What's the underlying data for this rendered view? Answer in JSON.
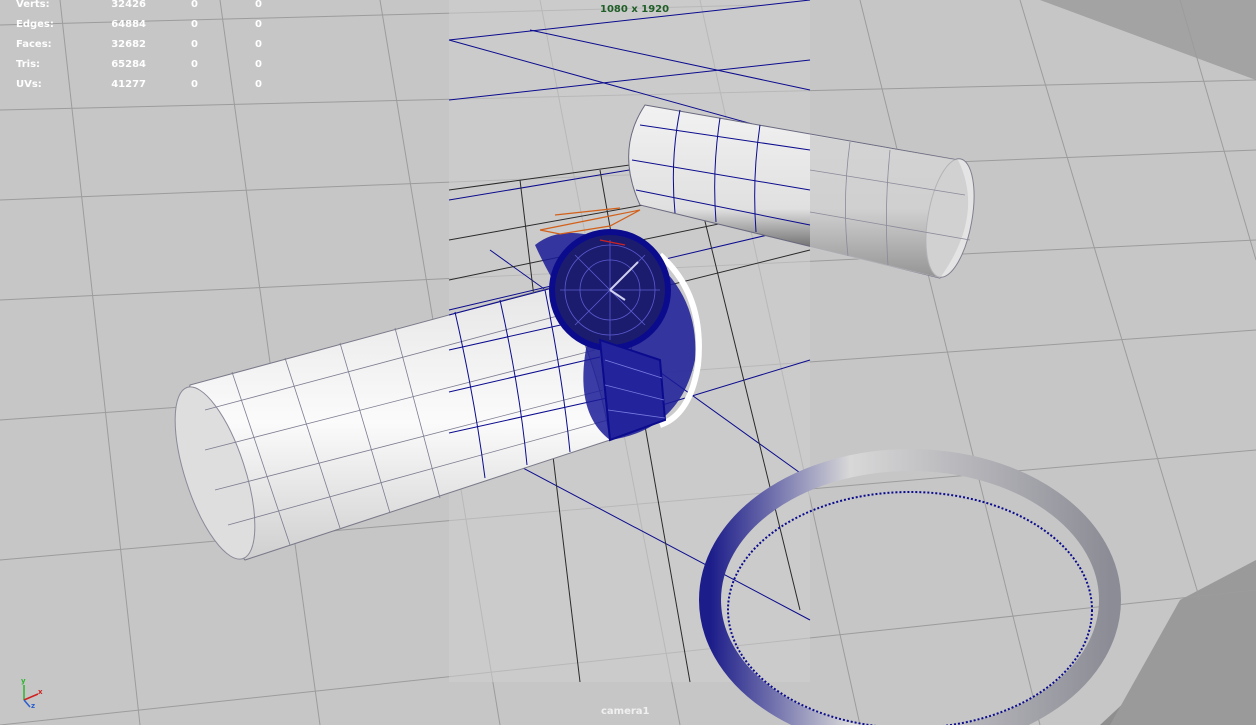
{
  "hud": {
    "rows": [
      {
        "label": "Verts:",
        "v1": "32426",
        "v2": "0",
        "v3": "0"
      },
      {
        "label": "Edges:",
        "v1": "64884",
        "v2": "0",
        "v3": "0"
      },
      {
        "label": "Faces:",
        "v1": "32682",
        "v2": "0",
        "v3": "0"
      },
      {
        "label": "Tris:",
        "v1": "65284",
        "v2": "0",
        "v3": "0"
      },
      {
        "label": "UVs:",
        "v1": "41277",
        "v2": "0",
        "v3": "0"
      }
    ]
  },
  "resolution_gate": "1080 x 1920",
  "camera_name": "camera1",
  "axis": {
    "x": "x",
    "y": "y",
    "z": "z"
  },
  "colors": {
    "wireframe_selected": "#0a0a8c",
    "grid_plane": "#c8c8c8",
    "resolution_text": "#1f5e27",
    "hud_text": "#ffffff"
  }
}
